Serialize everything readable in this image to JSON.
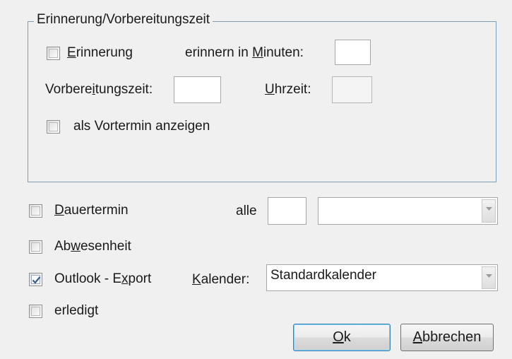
{
  "reminder_group": {
    "title": "Erinnerung/Vorbereitungszeit",
    "reminder_checkbox": {
      "label_pre": "",
      "mnemonic": "E",
      "label_post": "rinnerung",
      "checked": false
    },
    "remind_minutes": {
      "label_pre": "erinnern in ",
      "mnemonic": "M",
      "label_post": "inuten:",
      "value": ""
    },
    "prep_time": {
      "label_pre": "Vorbere",
      "mnemonic": "i",
      "label_post": "tungszeit:",
      "value": ""
    },
    "time": {
      "label_pre": "",
      "mnemonic": "U",
      "label_post": "hrzeit:",
      "value": ""
    },
    "pre_appointment_checkbox": {
      "label": "als Vortermin anzeigen",
      "checked": false
    }
  },
  "recurring": {
    "checkbox": {
      "label_pre": "",
      "mnemonic": "D",
      "label_post": "auertermin",
      "checked": false
    },
    "alle_label": "alle",
    "interval_value": "",
    "unit_value": ""
  },
  "absence_checkbox": {
    "label_pre": "Ab",
    "mnemonic": "w",
    "label_post": "esenheit",
    "checked": false
  },
  "outlook_export": {
    "checkbox": {
      "label_pre": "Outlook - E",
      "mnemonic": "x",
      "label_post": "port",
      "checked": true
    },
    "calendar_label_pre": "",
    "calendar_mnemonic": "K",
    "calendar_label_post": "alender:",
    "calendar_value": "Standardkalender"
  },
  "done_checkbox": {
    "label": "erledigt",
    "checked": false
  },
  "buttons": {
    "ok": {
      "mnemonic": "O",
      "label_post": "k"
    },
    "cancel": {
      "mnemonic": "A",
      "label_post": "bbrechen"
    }
  }
}
